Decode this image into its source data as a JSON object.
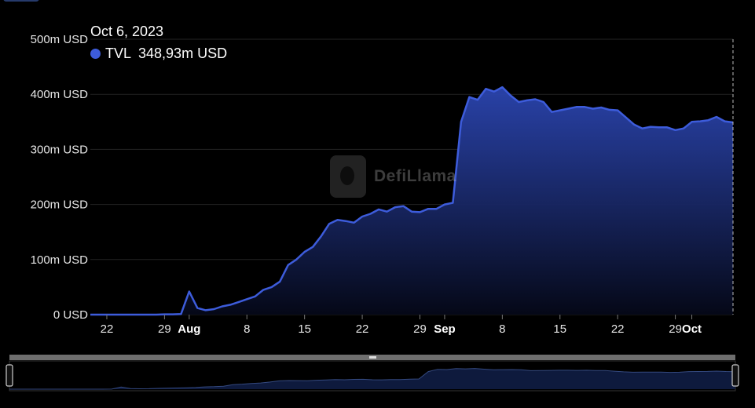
{
  "tooltip": {
    "date": "Oct 6, 2023",
    "series_name": "TVL",
    "value": "348,93m USD"
  },
  "watermark": "DefiLlama",
  "colors": {
    "line": "#3d5cdb",
    "fill_top": "#2b45b0",
    "fill_bottom": "#050817",
    "grid": "#232323"
  },
  "chart_data": {
    "type": "area",
    "series": [
      {
        "name": "TVL",
        "x": [
          "2023-07-20",
          "2023-07-21",
          "2023-07-22",
          "2023-07-23",
          "2023-07-24",
          "2023-07-25",
          "2023-07-26",
          "2023-07-27",
          "2023-07-28",
          "2023-07-29",
          "2023-07-30",
          "2023-07-31",
          "2023-08-01",
          "2023-08-02",
          "2023-08-03",
          "2023-08-04",
          "2023-08-05",
          "2023-08-06",
          "2023-08-07",
          "2023-08-08",
          "2023-08-09",
          "2023-08-10",
          "2023-08-11",
          "2023-08-12",
          "2023-08-13",
          "2023-08-14",
          "2023-08-15",
          "2023-08-16",
          "2023-08-17",
          "2023-08-18",
          "2023-08-19",
          "2023-08-20",
          "2023-08-21",
          "2023-08-22",
          "2023-08-23",
          "2023-08-24",
          "2023-08-25",
          "2023-08-26",
          "2023-08-27",
          "2023-08-28",
          "2023-08-29",
          "2023-08-30",
          "2023-08-31",
          "2023-09-01",
          "2023-09-02",
          "2023-09-03",
          "2023-09-04",
          "2023-09-05",
          "2023-09-06",
          "2023-09-07",
          "2023-09-08",
          "2023-09-09",
          "2023-09-10",
          "2023-09-11",
          "2023-09-12",
          "2023-09-13",
          "2023-09-14",
          "2023-09-15",
          "2023-09-16",
          "2023-09-17",
          "2023-09-18",
          "2023-09-19",
          "2023-09-20",
          "2023-09-21",
          "2023-09-22",
          "2023-09-23",
          "2023-09-24",
          "2023-09-25",
          "2023-09-26",
          "2023-09-27",
          "2023-09-28",
          "2023-09-29",
          "2023-09-30",
          "2023-10-01",
          "2023-10-02",
          "2023-10-03",
          "2023-10-04",
          "2023-10-05",
          "2023-10-06"
        ],
        "values": [
          0,
          0,
          0,
          0,
          0,
          0,
          0,
          0,
          0,
          0.5,
          0.5,
          1,
          42,
          12,
          8,
          10,
          15,
          18,
          23,
          28,
          33,
          45,
          50,
          60,
          90,
          100,
          114,
          123,
          142,
          165,
          172,
          170,
          167,
          178,
          183,
          191,
          187,
          195,
          197,
          187,
          186,
          192,
          192,
          200,
          203,
          350,
          395,
          390,
          410,
          405,
          413,
          398,
          386,
          389,
          391,
          386,
          368,
          371,
          374,
          377,
          377,
          374,
          376,
          372,
          371,
          358,
          345,
          338,
          341,
          340,
          340,
          335,
          338,
          350,
          351,
          353,
          359,
          351,
          349
        ]
      }
    ],
    "y_ticks": [
      0,
      100,
      200,
      300,
      400,
      500
    ],
    "y_tick_labels": [
      "0 USD",
      "100m USD",
      "200m USD",
      "300m USD",
      "400m USD",
      "500m USD"
    ],
    "ylim": [
      0,
      500
    ],
    "x_ticks": [
      {
        "x": "2023-07-22",
        "label": "22",
        "bold": false
      },
      {
        "x": "2023-07-29",
        "label": "29",
        "bold": false
      },
      {
        "x": "2023-08-01",
        "label": "Aug",
        "bold": true
      },
      {
        "x": "2023-08-08",
        "label": "8",
        "bold": false
      },
      {
        "x": "2023-08-15",
        "label": "15",
        "bold": false
      },
      {
        "x": "2023-08-22",
        "label": "22",
        "bold": false
      },
      {
        "x": "2023-08-29",
        "label": "29",
        "bold": false
      },
      {
        "x": "2023-09-01",
        "label": "Sep",
        "bold": true
      },
      {
        "x": "2023-09-08",
        "label": "8",
        "bold": false
      },
      {
        "x": "2023-09-15",
        "label": "15",
        "bold": false
      },
      {
        "x": "2023-09-22",
        "label": "22",
        "bold": false
      },
      {
        "x": "2023-09-29",
        "label": "29",
        "bold": false
      },
      {
        "x": "2023-10-01",
        "label": "Oct",
        "bold": true
      }
    ],
    "grid": true,
    "legend": "none",
    "cursor_date": "2023-10-06"
  }
}
